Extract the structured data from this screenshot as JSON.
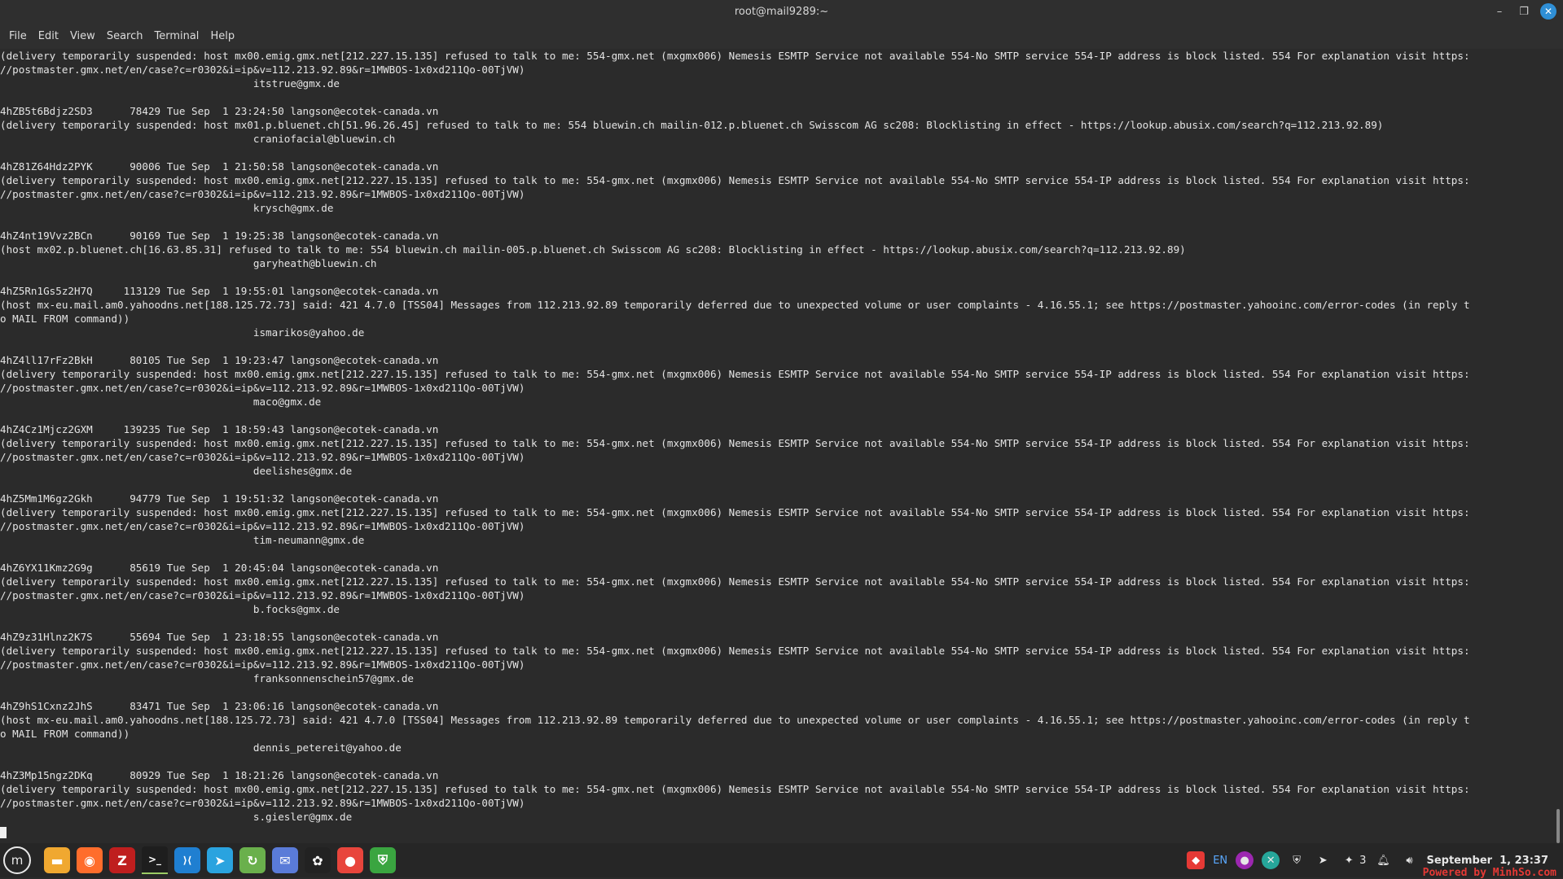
{
  "window": {
    "title": "root@mail9289:~",
    "minimize": "–",
    "maximize": "❐",
    "close": "✕"
  },
  "menu": [
    "File",
    "Edit",
    "View",
    "Search",
    "Terminal",
    "Help"
  ],
  "terminal": {
    "lines": [
      "(delivery temporarily suspended: host mx00.emig.gmx.net[212.227.15.135] refused to talk to me: 554-gmx.net (mxgmx006) Nemesis ESMTP Service not available 554-No SMTP service 554-IP address is block listed. 554 For explanation visit https:",
      "//postmaster.gmx.net/en/case?c=r0302&i=ip&v=112.213.92.89&r=1MWBOS-1x0xd211Qo-00TjVW)",
      "                                         itstrue@gmx.de",
      "",
      "4hZB5t6Bdjz2SD3      78429 Tue Sep  1 23:24:50 langson@ecotek-canada.vn",
      "(delivery temporarily suspended: host mx01.p.bluenet.ch[51.96.26.45] refused to talk to me: 554 bluewin.ch mailin-012.p.bluenet.ch Swisscom AG sc208: Blocklisting in effect - https://lookup.abusix.com/search?q=112.213.92.89)",
      "                                         craniofacial@bluewin.ch",
      "",
      "4hZ81Z64Hdz2PYK      90006 Tue Sep  1 21:50:58 langson@ecotek-canada.vn",
      "(delivery temporarily suspended: host mx00.emig.gmx.net[212.227.15.135] refused to talk to me: 554-gmx.net (mxgmx006) Nemesis ESMTP Service not available 554-No SMTP service 554-IP address is block listed. 554 For explanation visit https:",
      "//postmaster.gmx.net/en/case?c=r0302&i=ip&v=112.213.92.89&r=1MWBOS-1x0xd211Qo-00TjVW)",
      "                                         krysch@gmx.de",
      "",
      "4hZ4nt19Vvz2BCn      90169 Tue Sep  1 19:25:38 langson@ecotek-canada.vn",
      "(host mx02.p.bluenet.ch[16.63.85.31] refused to talk to me: 554 bluewin.ch mailin-005.p.bluenet.ch Swisscom AG sc208: Blocklisting in effect - https://lookup.abusix.com/search?q=112.213.92.89)",
      "                                         garyheath@bluewin.ch",
      "",
      "4hZ5Rn1Gs5z2H7Q     113129 Tue Sep  1 19:55:01 langson@ecotek-canada.vn",
      "(host mx-eu.mail.am0.yahoodns.net[188.125.72.73] said: 421 4.7.0 [TSS04] Messages from 112.213.92.89 temporarily deferred due to unexpected volume or user complaints - 4.16.55.1; see https://postmaster.yahooinc.com/error-codes (in reply t",
      "o MAIL FROM command))",
      "                                         ismarikos@yahoo.de",
      "",
      "4hZ4ll17rFz2BkH      80105 Tue Sep  1 19:23:47 langson@ecotek-canada.vn",
      "(delivery temporarily suspended: host mx00.emig.gmx.net[212.227.15.135] refused to talk to me: 554-gmx.net (mxgmx006) Nemesis ESMTP Service not available 554-No SMTP service 554-IP address is block listed. 554 For explanation visit https:",
      "//postmaster.gmx.net/en/case?c=r0302&i=ip&v=112.213.92.89&r=1MWBOS-1x0xd211Qo-00TjVW)",
      "                                         maco@gmx.de",
      "",
      "4hZ4Cz1Mjcz2GXM     139235 Tue Sep  1 18:59:43 langson@ecotek-canada.vn",
      "(delivery temporarily suspended: host mx00.emig.gmx.net[212.227.15.135] refused to talk to me: 554-gmx.net (mxgmx006) Nemesis ESMTP Service not available 554-No SMTP service 554-IP address is block listed. 554 For explanation visit https:",
      "//postmaster.gmx.net/en/case?c=r0302&i=ip&v=112.213.92.89&r=1MWBOS-1x0xd211Qo-00TjVW)",
      "                                         deelishes@gmx.de",
      "",
      "4hZ5Mm1M6gz2Gkh      94779 Tue Sep  1 19:51:32 langson@ecotek-canada.vn",
      "(delivery temporarily suspended: host mx00.emig.gmx.net[212.227.15.135] refused to talk to me: 554-gmx.net (mxgmx006) Nemesis ESMTP Service not available 554-No SMTP service 554-IP address is block listed. 554 For explanation visit https:",
      "//postmaster.gmx.net/en/case?c=r0302&i=ip&v=112.213.92.89&r=1MWBOS-1x0xd211Qo-00TjVW)",
      "                                         tim-neumann@gmx.de",
      "",
      "4hZ6YX11Kmz2G9g      85619 Tue Sep  1 20:45:04 langson@ecotek-canada.vn",
      "(delivery temporarily suspended: host mx00.emig.gmx.net[212.227.15.135] refused to talk to me: 554-gmx.net (mxgmx006) Nemesis ESMTP Service not available 554-No SMTP service 554-IP address is block listed. 554 For explanation visit https:",
      "//postmaster.gmx.net/en/case?c=r0302&i=ip&v=112.213.92.89&r=1MWBOS-1x0xd211Qo-00TjVW)",
      "                                         b.focks@gmx.de",
      "",
      "4hZ9z31Hlnz2K7S      55694 Tue Sep  1 23:18:55 langson@ecotek-canada.vn",
      "(delivery temporarily suspended: host mx00.emig.gmx.net[212.227.15.135] refused to talk to me: 554-gmx.net (mxgmx006) Nemesis ESMTP Service not available 554-No SMTP service 554-IP address is block listed. 554 For explanation visit https:",
      "//postmaster.gmx.net/en/case?c=r0302&i=ip&v=112.213.92.89&r=1MWBOS-1x0xd211Qo-00TjVW)",
      "                                         franksonnenschein57@gmx.de",
      "",
      "4hZ9hS1Cxnz2JhS      83471 Tue Sep  1 23:06:16 langson@ecotek-canada.vn",
      "(host mx-eu.mail.am0.yahoodns.net[188.125.72.73] said: 421 4.7.0 [TSS04] Messages from 112.213.92.89 temporarily deferred due to unexpected volume or user complaints - 4.16.55.1; see https://postmaster.yahooinc.com/error-codes (in reply t",
      "o MAIL FROM command))",
      "                                         dennis_petereit@yahoo.de",
      "",
      "4hZ3Mp15ngz2DKq      80929 Tue Sep  1 18:21:26 langson@ecotek-canada.vn",
      "(delivery temporarily suspended: host mx00.emig.gmx.net[212.227.15.135] refused to talk to me: 554-gmx.net (mxgmx006) Nemesis ESMTP Service not available 554-No SMTP service 554-IP address is block listed. 554 For explanation visit https:",
      "//postmaster.gmx.net/en/case?c=r0302&i=ip&v=112.213.92.89&r=1MWBOS-1x0xd211Qo-00TjVW)",
      "                                         s.giesler@gmx.de"
    ]
  },
  "taskbar": {
    "apps": [
      {
        "name": "files-app-icon",
        "glyph": "▬",
        "bg": "#f0a830"
      },
      {
        "name": "firefox-app-icon",
        "glyph": "◉",
        "bg": "#ff6d2c"
      },
      {
        "name": "filezilla-app-icon",
        "glyph": "Z",
        "bg": "#bf1e1e"
      },
      {
        "name": "terminal-app-icon",
        "glyph": ">_",
        "bg": "#1e1e1e"
      },
      {
        "name": "vscode-app-icon",
        "glyph": "⟩⟨",
        "bg": "#1f7fd1"
      },
      {
        "name": "telegram-app-icon",
        "glyph": "➤",
        "bg": "#2aa3df"
      },
      {
        "name": "update-manager-app-icon",
        "glyph": "↻",
        "bg": "#6ab04c"
      },
      {
        "name": "mail-app-icon",
        "glyph": "✉",
        "bg": "#5a7bd8"
      },
      {
        "name": "chatgpt-app-icon",
        "glyph": "✿",
        "bg": "#222222"
      },
      {
        "name": "chrome-app-icon",
        "glyph": "●",
        "bg": "#e8453c"
      },
      {
        "name": "vpn-shield-app-icon",
        "glyph": "⛨",
        "bg": "#3aa540"
      }
    ],
    "tray": {
      "anydesk_glyph": "◆",
      "language": "EN",
      "notification_count": "3",
      "clock": "September  1, 23:37"
    }
  },
  "watermark": "Powered by MinhSo.com"
}
